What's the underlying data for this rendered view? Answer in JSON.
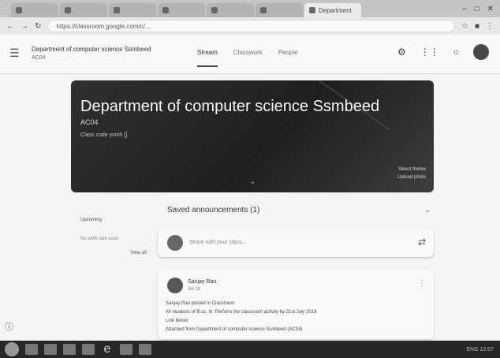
{
  "browser": {
    "tabs": [
      {
        "label": "",
        "active": false
      },
      {
        "label": "",
        "active": false
      },
      {
        "label": "",
        "active": false
      },
      {
        "label": "",
        "active": false
      },
      {
        "label": "",
        "active": false
      },
      {
        "label": "",
        "active": false
      },
      {
        "label": "Department",
        "active": true
      }
    ],
    "url": "https://classroom.google.com/c/..."
  },
  "header": {
    "class_title": "Department of computer science Ssmbeed",
    "class_section": "AC04",
    "tabs": [
      "Stream",
      "Classwork",
      "People"
    ]
  },
  "banner": {
    "title": "Department of computer science Ssmbeed",
    "section": "AC04",
    "class_code": "Class code  yvmh []",
    "select_theme": "Select theme",
    "upload_photo": "Upload photo"
  },
  "stream": {
    "saved_label": "Saved announcements (1)",
    "upcoming": {
      "title": "Upcoming",
      "body": "No work due soon",
      "link": "View all"
    },
    "compose_placeholder": "Share with your class...",
    "post": {
      "author": "Sanjay Rao",
      "date": "Jul 18",
      "lines": [
        "Sanjay Rao posted in Classroom",
        "All students of B.sc. III: Perform the classroom activity by 21st July 2018",
        "Link below",
        "Attached from Department of computer science Ssmbeed (AC04)"
      ]
    }
  },
  "taskbar": {
    "tray_text": "ENG  12:07"
  },
  "colors": {
    "banner": "#1f1f1f",
    "background": "#f4f4f4",
    "taskbar": "#222222"
  }
}
